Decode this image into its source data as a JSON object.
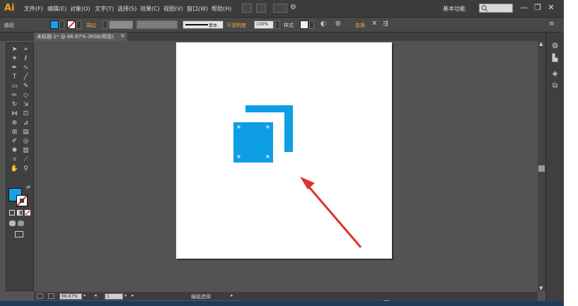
{
  "app": {
    "logo": "Ai",
    "menus": [
      "文件(F)",
      "编辑(E)",
      "对象(O)",
      "文字(T)",
      "选择(S)",
      "效果(C)",
      "视图(V)",
      "窗口(W)",
      "帮助(H)"
    ],
    "workspace": "基本功能",
    "window_buttons": [
      "—",
      "❐",
      "✕"
    ]
  },
  "control_bar": {
    "object_type": "路径",
    "stroke_label": "描边",
    "stroke_profile": "基本",
    "opacity_label": "不透明度",
    "opacity_value": "100%",
    "style_label": "样式",
    "transform_label": "变换"
  },
  "document": {
    "tab_title": "未标题-1* @ 66.67% (RGB/预览)",
    "tab_close": "×"
  },
  "status_bar": {
    "zoom": "66.67%",
    "page": "1",
    "tool_text": "编组选择"
  },
  "colors": {
    "fill": "#1aa0e6",
    "shape_blue": "#0d9ee4",
    "arrow_red": "#e0322e",
    "brand_orange": "#f7a21b"
  },
  "icons": {
    "tools": [
      "selection-tool-icon",
      "direct-selection-tool-icon",
      "magic-wand-icon",
      "lasso-icon",
      "pen-tool-icon",
      "curvature-icon",
      "type-tool-icon",
      "line-tool-icon",
      "rectangle-tool-icon",
      "paintbrush-icon",
      "pencil-icon",
      "eraser-icon",
      "rotate-tool-icon",
      "scale-tool-icon",
      "width-tool-icon",
      "free-transform-icon",
      "shape-builder-icon",
      "perspective-icon",
      "mesh-icon",
      "gradient-icon",
      "eyedropper-icon",
      "blend-icon",
      "symbol-sprayer-icon",
      "graph-tool-icon",
      "artboard-tool-icon",
      "slice-tool-icon",
      "hand-tool-icon",
      "zoom-tool-icon"
    ],
    "right_panel": [
      "color-panel-icon",
      "swatches-icon",
      "layers-icon",
      "artboards-panel-icon"
    ]
  }
}
